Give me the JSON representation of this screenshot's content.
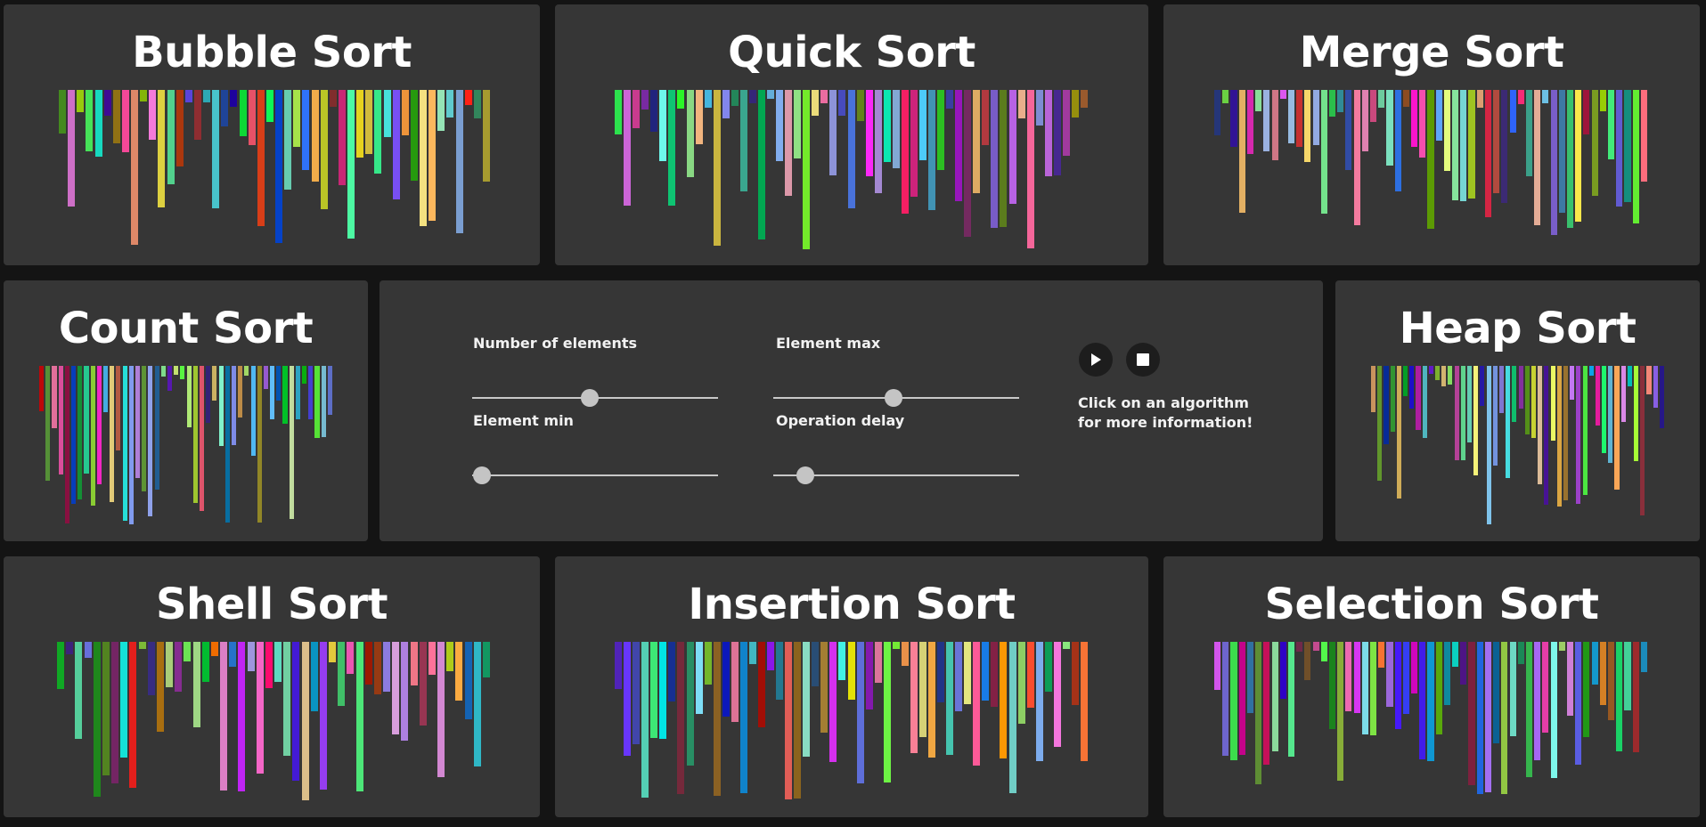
{
  "algorithms": [
    {
      "key": "bubble",
      "title": "Bubble Sort",
      "count": 48,
      "seed": 11
    },
    {
      "key": "quick",
      "title": "Quick Sort",
      "count": 53,
      "seed": 23
    },
    {
      "key": "merge",
      "title": "Merge Sort",
      "count": 53,
      "seed": 37
    },
    {
      "key": "count",
      "title": "Count Sort",
      "count": 46,
      "seed": 41
    },
    {
      "key": "heap",
      "title": "Heap Sort",
      "count": 46,
      "seed": 53
    },
    {
      "key": "shell",
      "title": "Shell Sort",
      "count": 48,
      "seed": 67
    },
    {
      "key": "insertion",
      "title": "Insertion Sort",
      "count": 53,
      "seed": 71
    },
    {
      "key": "selection",
      "title": "Selection Sort",
      "count": 53,
      "seed": 83
    }
  ],
  "controls": {
    "num_elements_label": "Number of elements",
    "element_max_label": "Element max",
    "element_min_label": "Element min",
    "operation_delay_label": "Operation delay",
    "num_elements_value": 0.48,
    "element_max_value": 0.49,
    "element_min_value": 0.04,
    "operation_delay_value": 0.13,
    "play_icon": "play-icon",
    "stop_icon": "stop-icon",
    "help_text_line1": "Click on an algorithm",
    "help_text_line2": "for more information!"
  }
}
